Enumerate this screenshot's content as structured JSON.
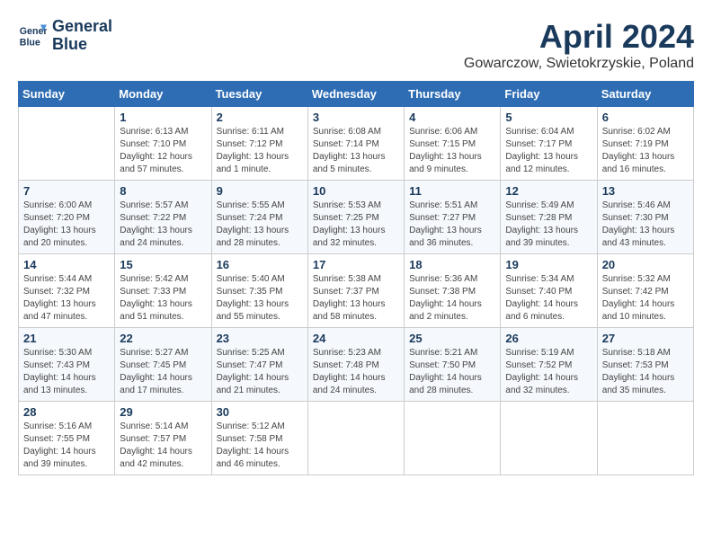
{
  "header": {
    "logo_line1": "General",
    "logo_line2": "Blue",
    "month": "April 2024",
    "location": "Gowarczow, Swietokrzyskie, Poland"
  },
  "weekdays": [
    "Sunday",
    "Monday",
    "Tuesday",
    "Wednesday",
    "Thursday",
    "Friday",
    "Saturday"
  ],
  "weeks": [
    [
      {
        "day": "",
        "sunrise": "",
        "sunset": "",
        "daylight": ""
      },
      {
        "day": "1",
        "sunrise": "Sunrise: 6:13 AM",
        "sunset": "Sunset: 7:10 PM",
        "daylight": "Daylight: 12 hours and 57 minutes."
      },
      {
        "day": "2",
        "sunrise": "Sunrise: 6:11 AM",
        "sunset": "Sunset: 7:12 PM",
        "daylight": "Daylight: 13 hours and 1 minute."
      },
      {
        "day": "3",
        "sunrise": "Sunrise: 6:08 AM",
        "sunset": "Sunset: 7:14 PM",
        "daylight": "Daylight: 13 hours and 5 minutes."
      },
      {
        "day": "4",
        "sunrise": "Sunrise: 6:06 AM",
        "sunset": "Sunset: 7:15 PM",
        "daylight": "Daylight: 13 hours and 9 minutes."
      },
      {
        "day": "5",
        "sunrise": "Sunrise: 6:04 AM",
        "sunset": "Sunset: 7:17 PM",
        "daylight": "Daylight: 13 hours and 12 minutes."
      },
      {
        "day": "6",
        "sunrise": "Sunrise: 6:02 AM",
        "sunset": "Sunset: 7:19 PM",
        "daylight": "Daylight: 13 hours and 16 minutes."
      }
    ],
    [
      {
        "day": "7",
        "sunrise": "Sunrise: 6:00 AM",
        "sunset": "Sunset: 7:20 PM",
        "daylight": "Daylight: 13 hours and 20 minutes."
      },
      {
        "day": "8",
        "sunrise": "Sunrise: 5:57 AM",
        "sunset": "Sunset: 7:22 PM",
        "daylight": "Daylight: 13 hours and 24 minutes."
      },
      {
        "day": "9",
        "sunrise": "Sunrise: 5:55 AM",
        "sunset": "Sunset: 7:24 PM",
        "daylight": "Daylight: 13 hours and 28 minutes."
      },
      {
        "day": "10",
        "sunrise": "Sunrise: 5:53 AM",
        "sunset": "Sunset: 7:25 PM",
        "daylight": "Daylight: 13 hours and 32 minutes."
      },
      {
        "day": "11",
        "sunrise": "Sunrise: 5:51 AM",
        "sunset": "Sunset: 7:27 PM",
        "daylight": "Daylight: 13 hours and 36 minutes."
      },
      {
        "day": "12",
        "sunrise": "Sunrise: 5:49 AM",
        "sunset": "Sunset: 7:28 PM",
        "daylight": "Daylight: 13 hours and 39 minutes."
      },
      {
        "day": "13",
        "sunrise": "Sunrise: 5:46 AM",
        "sunset": "Sunset: 7:30 PM",
        "daylight": "Daylight: 13 hours and 43 minutes."
      }
    ],
    [
      {
        "day": "14",
        "sunrise": "Sunrise: 5:44 AM",
        "sunset": "Sunset: 7:32 PM",
        "daylight": "Daylight: 13 hours and 47 minutes."
      },
      {
        "day": "15",
        "sunrise": "Sunrise: 5:42 AM",
        "sunset": "Sunset: 7:33 PM",
        "daylight": "Daylight: 13 hours and 51 minutes."
      },
      {
        "day": "16",
        "sunrise": "Sunrise: 5:40 AM",
        "sunset": "Sunset: 7:35 PM",
        "daylight": "Daylight: 13 hours and 55 minutes."
      },
      {
        "day": "17",
        "sunrise": "Sunrise: 5:38 AM",
        "sunset": "Sunset: 7:37 PM",
        "daylight": "Daylight: 13 hours and 58 minutes."
      },
      {
        "day": "18",
        "sunrise": "Sunrise: 5:36 AM",
        "sunset": "Sunset: 7:38 PM",
        "daylight": "Daylight: 14 hours and 2 minutes."
      },
      {
        "day": "19",
        "sunrise": "Sunrise: 5:34 AM",
        "sunset": "Sunset: 7:40 PM",
        "daylight": "Daylight: 14 hours and 6 minutes."
      },
      {
        "day": "20",
        "sunrise": "Sunrise: 5:32 AM",
        "sunset": "Sunset: 7:42 PM",
        "daylight": "Daylight: 14 hours and 10 minutes."
      }
    ],
    [
      {
        "day": "21",
        "sunrise": "Sunrise: 5:30 AM",
        "sunset": "Sunset: 7:43 PM",
        "daylight": "Daylight: 14 hours and 13 minutes."
      },
      {
        "day": "22",
        "sunrise": "Sunrise: 5:27 AM",
        "sunset": "Sunset: 7:45 PM",
        "daylight": "Daylight: 14 hours and 17 minutes."
      },
      {
        "day": "23",
        "sunrise": "Sunrise: 5:25 AM",
        "sunset": "Sunset: 7:47 PM",
        "daylight": "Daylight: 14 hours and 21 minutes."
      },
      {
        "day": "24",
        "sunrise": "Sunrise: 5:23 AM",
        "sunset": "Sunset: 7:48 PM",
        "daylight": "Daylight: 14 hours and 24 minutes."
      },
      {
        "day": "25",
        "sunrise": "Sunrise: 5:21 AM",
        "sunset": "Sunset: 7:50 PM",
        "daylight": "Daylight: 14 hours and 28 minutes."
      },
      {
        "day": "26",
        "sunrise": "Sunrise: 5:19 AM",
        "sunset": "Sunset: 7:52 PM",
        "daylight": "Daylight: 14 hours and 32 minutes."
      },
      {
        "day": "27",
        "sunrise": "Sunrise: 5:18 AM",
        "sunset": "Sunset: 7:53 PM",
        "daylight": "Daylight: 14 hours and 35 minutes."
      }
    ],
    [
      {
        "day": "28",
        "sunrise": "Sunrise: 5:16 AM",
        "sunset": "Sunset: 7:55 PM",
        "daylight": "Daylight: 14 hours and 39 minutes."
      },
      {
        "day": "29",
        "sunrise": "Sunrise: 5:14 AM",
        "sunset": "Sunset: 7:57 PM",
        "daylight": "Daylight: 14 hours and 42 minutes."
      },
      {
        "day": "30",
        "sunrise": "Sunrise: 5:12 AM",
        "sunset": "Sunset: 7:58 PM",
        "daylight": "Daylight: 14 hours and 46 minutes."
      },
      {
        "day": "",
        "sunrise": "",
        "sunset": "",
        "daylight": ""
      },
      {
        "day": "",
        "sunrise": "",
        "sunset": "",
        "daylight": ""
      },
      {
        "day": "",
        "sunrise": "",
        "sunset": "",
        "daylight": ""
      },
      {
        "day": "",
        "sunrise": "",
        "sunset": "",
        "daylight": ""
      }
    ]
  ]
}
